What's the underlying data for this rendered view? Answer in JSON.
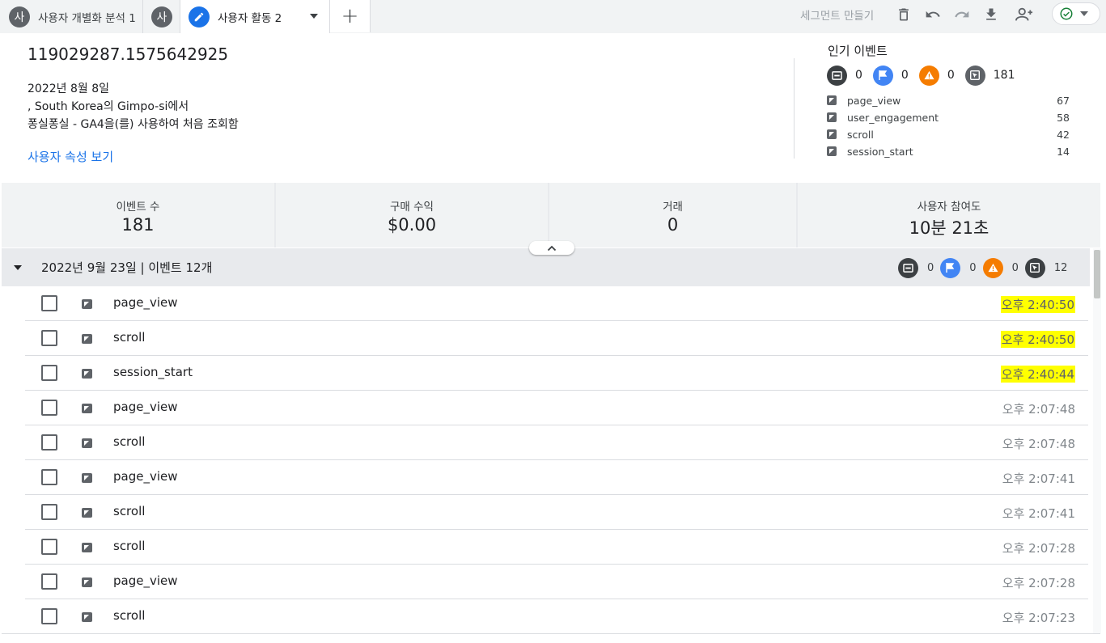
{
  "tabs": [
    {
      "label": "사용자 개별화 분석 1",
      "avatar": "사"
    },
    {
      "label": "",
      "avatar": "사"
    },
    {
      "label": "사용자 활동 2",
      "icon": "pencil-icon"
    },
    {
      "label": "+"
    }
  ],
  "toolbar": {
    "create_segment": "세그먼트 만들기",
    "icons": [
      "delete-icon",
      "undo-icon",
      "redo-icon",
      "download-icon",
      "share-user-icon",
      "check-circle-icon"
    ]
  },
  "user": {
    "id": "119029287.1575642925",
    "first_seen_date": "2022년 8월 8일",
    "location": ", South Korea의 Gimpo-si에서",
    "first_seen_desc": "퐁실퐁실 - GA4을(를) 사용하여 처음 조회함",
    "view_properties_link": "사용자 속성 보기"
  },
  "popular_events": {
    "title": "인기 이벤트",
    "counts": {
      "conversions": "0",
      "flags": "0",
      "errors": "0",
      "events": "181"
    },
    "items": [
      {
        "name": "page_view",
        "count": "67"
      },
      {
        "name": "user_engagement",
        "count": "58"
      },
      {
        "name": "scroll",
        "count": "42"
      },
      {
        "name": "session_start",
        "count": "14"
      }
    ]
  },
  "metrics": [
    {
      "label": "이벤트 수",
      "value": "181"
    },
    {
      "label": "구매 수익",
      "value": "$0.00"
    },
    {
      "label": "거래",
      "value": "0"
    },
    {
      "label": "사용자 참여도",
      "value": "10분 21초"
    }
  ],
  "day_group": {
    "title": "2022년 9월 23일 | 이벤트 12개",
    "counts": {
      "conversions": "0",
      "flags": "0",
      "errors": "0",
      "events": "12"
    },
    "events": [
      {
        "name": "page_view",
        "time": "오후 2:40:50",
        "highlighted": true
      },
      {
        "name": "scroll",
        "time": "오후 2:40:50",
        "highlighted": true
      },
      {
        "name": "session_start",
        "time": "오후 2:40:44",
        "highlighted": true
      },
      {
        "name": "page_view",
        "time": "오후 2:07:48",
        "highlighted": false
      },
      {
        "name": "scroll",
        "time": "오후 2:07:48",
        "highlighted": false
      },
      {
        "name": "page_view",
        "time": "오후 2:07:41",
        "highlighted": false
      },
      {
        "name": "scroll",
        "time": "오후 2:07:41",
        "highlighted": false
      },
      {
        "name": "scroll",
        "time": "오후 2:07:28",
        "highlighted": false
      },
      {
        "name": "page_view",
        "time": "오후 2:07:28",
        "highlighted": false
      },
      {
        "name": "scroll",
        "time": "오후 2:07:23",
        "highlighted": false
      }
    ]
  },
  "colors": {
    "accent": "#1a73e8",
    "highlight": "#ffff00",
    "error_orange": "#f57c00",
    "flag_blue": "#4285f4"
  }
}
